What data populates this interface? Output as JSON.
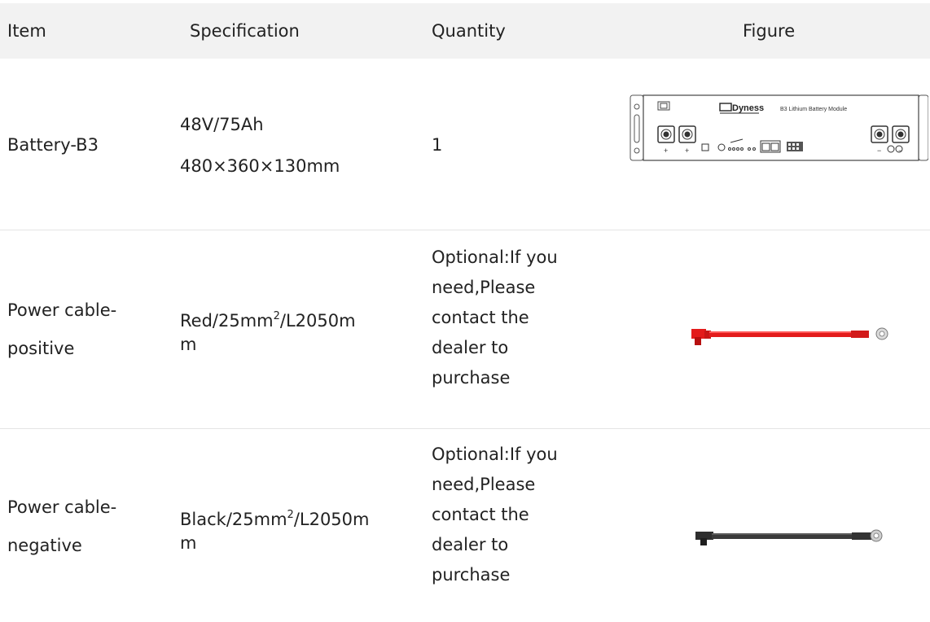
{
  "table": {
    "headers": {
      "item": "Item",
      "specification": "Specification",
      "quantity": "Quantity",
      "figure": "Figure"
    },
    "rows": [
      {
        "item": "Battery-B3",
        "spec_line1": "48V/75Ah",
        "spec_line2": "480×360×130mm",
        "quantity": "1",
        "figure": {
          "brand": "Dyness",
          "module_label": "B3 Lithium Battery Module",
          "plus": "+",
          "minus": "−"
        }
      },
      {
        "item_line1": "Power cable-",
        "item_line2": "positive",
        "spec_prefix": "Red/25mm",
        "spec_sup": "2",
        "spec_suffix": "/L2050m",
        "spec_line2": "m",
        "quantity_lines": [
          "Optional:If you",
          "need,Please",
          "contact the",
          "dealer to",
          "purchase"
        ],
        "cable_color": "#e31b1b"
      },
      {
        "item_line1": "Power cable-",
        "item_line2": "negative",
        "spec_prefix": "Black/25mm",
        "spec_sup": "2",
        "spec_suffix": "/L2050m",
        "spec_line2": "m",
        "quantity_lines": [
          "Optional:If you",
          "need,Please",
          "contact the",
          "dealer to",
          "purchase"
        ],
        "cable_color": "#3a3a3a"
      }
    ]
  }
}
